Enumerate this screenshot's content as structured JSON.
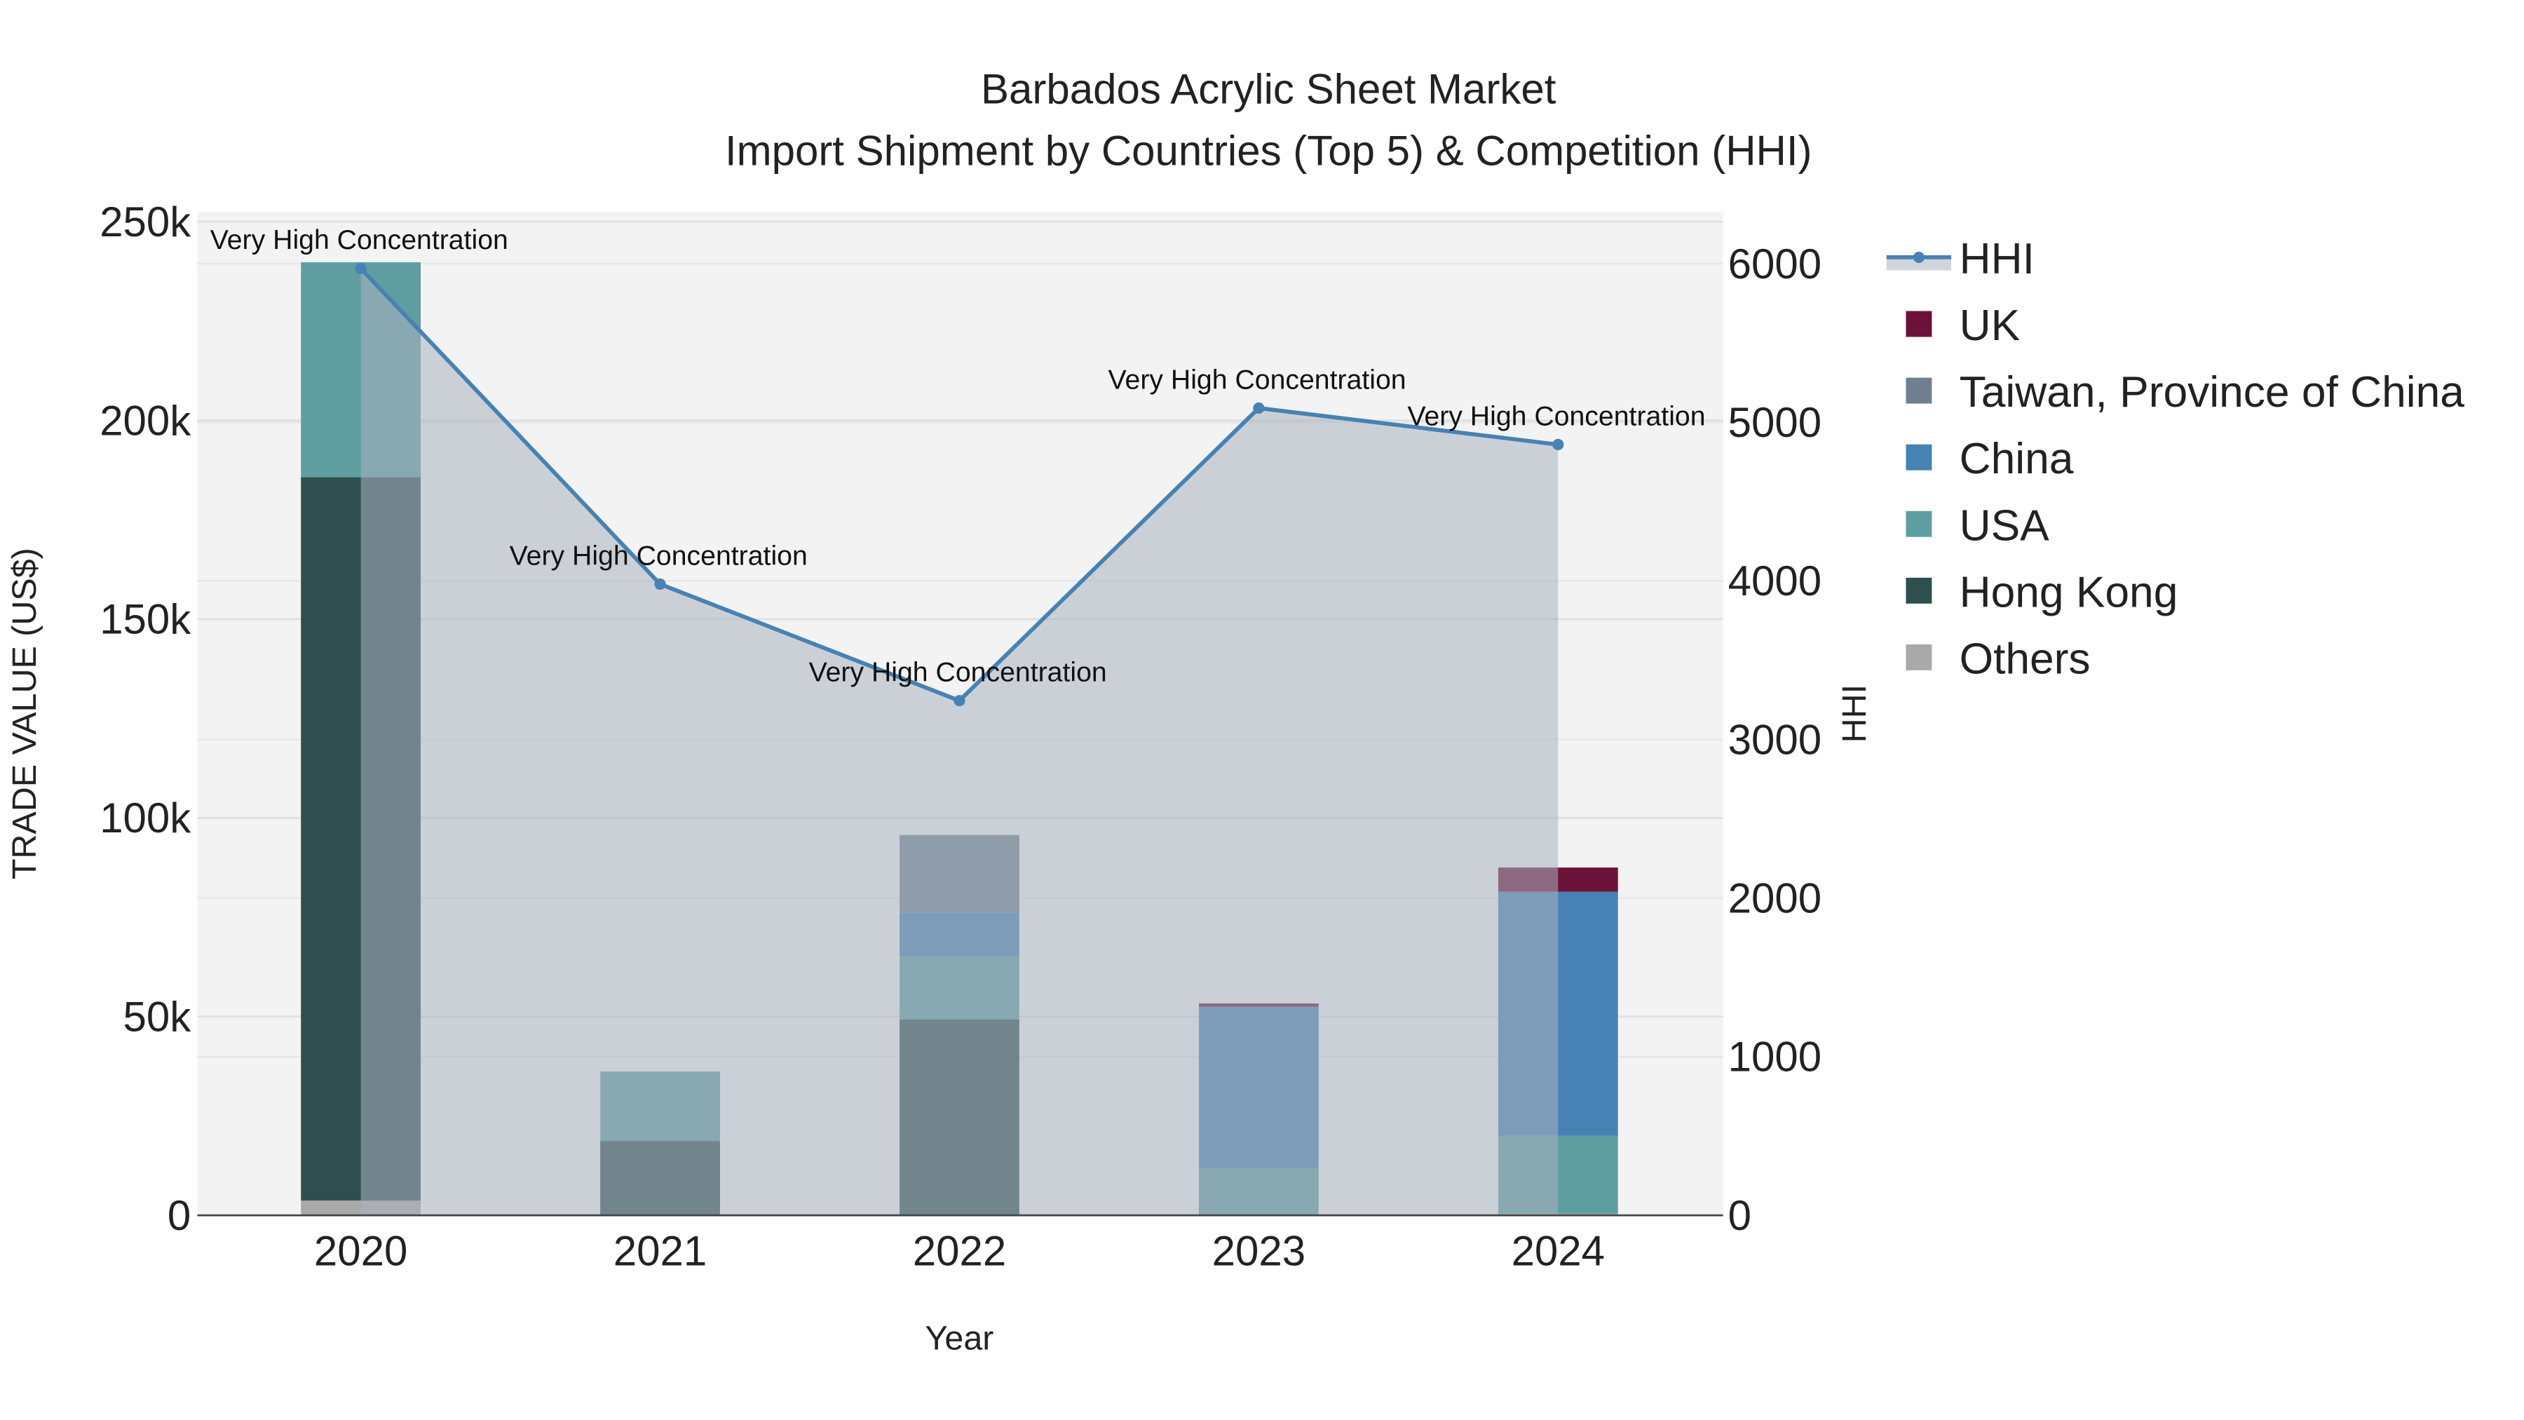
{
  "chart_data": {
    "type": "bar",
    "title": "Barbados Acrylic Sheet Market",
    "subtitle": "Import Shipment by Countries (Top 5) & Competition (HHI)",
    "xlabel": "Year",
    "ylabel": "TRADE VALUE (US$)",
    "y2label": "HHI",
    "categories": [
      "2020",
      "2021",
      "2022",
      "2023",
      "2024"
    ],
    "ylim": [
      0,
      250000
    ],
    "y2lim": [
      0,
      6300
    ],
    "yticks": [
      {
        "v": 0,
        "label": "0"
      },
      {
        "v": 50000,
        "label": "50k"
      },
      {
        "v": 100000,
        "label": "100k"
      },
      {
        "v": 150000,
        "label": "150k"
      },
      {
        "v": 200000,
        "label": "200k"
      },
      {
        "v": 250000,
        "label": "250k"
      }
    ],
    "y2ticks": [
      {
        "v": 0,
        "label": "0"
      },
      {
        "v": 1000,
        "label": "1000"
      },
      {
        "v": 2000,
        "label": "2000"
      },
      {
        "v": 3000,
        "label": "3000"
      },
      {
        "v": 4000,
        "label": "4000"
      },
      {
        "v": 5000,
        "label": "5000"
      },
      {
        "v": 6000,
        "label": "6000"
      }
    ],
    "stacked": true,
    "series": [
      {
        "name": "Others",
        "color": "#a9a9a9",
        "values": [
          3700,
          0,
          0,
          0,
          400
        ]
      },
      {
        "name": "Hong Kong",
        "color": "#2f4f4f",
        "values": [
          182000,
          18700,
          49300,
          0,
          0
        ]
      },
      {
        "name": "USA",
        "color": "#5f9ea0",
        "values": [
          54100,
          17500,
          15800,
          11800,
          19600
        ]
      },
      {
        "name": "China",
        "color": "#4682b4",
        "values": [
          0,
          0,
          11000,
          40700,
          61400
        ]
      },
      {
        "name": "Taiwan, Province of China",
        "color": "#708090",
        "values": [
          0,
          0,
          19600,
          0,
          0
        ]
      },
      {
        "name": "UK",
        "color": "#6b1238",
        "values": [
          0,
          0,
          0,
          800,
          6100
        ]
      }
    ],
    "hhi": {
      "name": "HHI",
      "color": "#4682b4",
      "values": [
        5970,
        3980,
        3245,
        5090,
        4860
      ],
      "annotations": [
        "Very High Concentration",
        "Very High Concentration",
        "Very High Concentration",
        "Very High Concentration",
        "Very High Concentration"
      ]
    },
    "legend": [
      "HHI",
      "UK",
      "Taiwan, Province of China",
      "China",
      "USA",
      "Hong Kong",
      "Others"
    ],
    "legend_position": "right",
    "grid": true
  }
}
